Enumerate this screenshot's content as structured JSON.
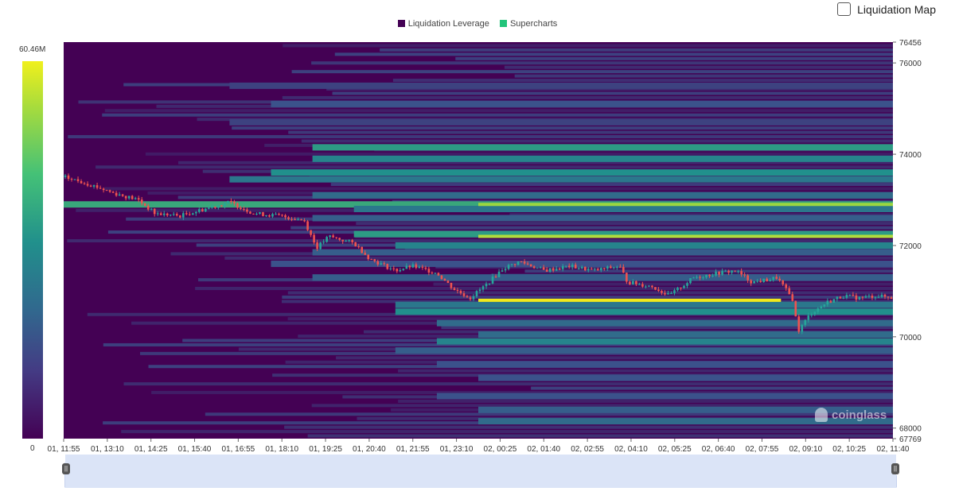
{
  "legend": [
    {
      "label": "Liquidation Leverage",
      "color": "#440154"
    },
    {
      "label": "Supercharts",
      "color": "#22c47a"
    }
  ],
  "toggle": {
    "label": "Liquidation Map",
    "checked": false
  },
  "color_scale": {
    "max_label": "60.46M",
    "min_label": "0"
  },
  "watermark": "coinglass",
  "chart_data": {
    "type": "heatmap",
    "ylim": [
      67769,
      76456
    ],
    "y_ticks": [
      "76456",
      "76000",
      "74000",
      "72000",
      "70000",
      "68000",
      "67769"
    ],
    "x_ticks": [
      "01, 11:55",
      "01, 13:10",
      "01, 14:25",
      "01, 15:40",
      "01, 16:55",
      "01, 18:10",
      "01, 19:25",
      "01, 20:40",
      "01, 21:55",
      "01, 23:10",
      "02, 00:25",
      "02, 01:40",
      "02, 02:55",
      "02, 04:10",
      "02, 05:25",
      "02, 06:40",
      "02, 07:55",
      "02, 09:10",
      "02, 10:25",
      "02, 11:40"
    ],
    "colorscale": [
      "#440154",
      "#3b528b",
      "#21908c",
      "#5ec962",
      "#fde725"
    ],
    "liquidation_levels": [
      {
        "price": 72900,
        "start": 0.0,
        "end": 1.0,
        "intensity": 0.6
      },
      {
        "price": 72250,
        "start": 0.35,
        "end": 1.0,
        "intensity": 0.55
      },
      {
        "price": 74150,
        "start": 0.3,
        "end": 1.0,
        "intensity": 0.55
      },
      {
        "price": 73900,
        "start": 0.3,
        "end": 1.0,
        "intensity": 0.45
      },
      {
        "price": 73600,
        "start": 0.25,
        "end": 1.0,
        "intensity": 0.5
      },
      {
        "price": 73450,
        "start": 0.2,
        "end": 1.0,
        "intensity": 0.4
      },
      {
        "price": 73100,
        "start": 0.3,
        "end": 1.0,
        "intensity": 0.35
      },
      {
        "price": 72800,
        "start": 0.35,
        "end": 1.0,
        "intensity": 0.4
      },
      {
        "price": 72600,
        "start": 0.3,
        "end": 1.0,
        "intensity": 0.3
      },
      {
        "price": 72000,
        "start": 0.4,
        "end": 1.0,
        "intensity": 0.45
      },
      {
        "price": 71850,
        "start": 0.3,
        "end": 1.0,
        "intensity": 0.3
      },
      {
        "price": 71600,
        "start": 0.25,
        "end": 1.0,
        "intensity": 0.25
      },
      {
        "price": 71300,
        "start": 0.3,
        "end": 1.0,
        "intensity": 0.3
      },
      {
        "price": 70700,
        "start": 0.4,
        "end": 1.0,
        "intensity": 0.4
      },
      {
        "price": 70550,
        "start": 0.4,
        "end": 1.0,
        "intensity": 0.5
      },
      {
        "price": 70300,
        "start": 0.45,
        "end": 1.0,
        "intensity": 0.35
      },
      {
        "price": 70050,
        "start": 0.5,
        "end": 1.0,
        "intensity": 0.35
      },
      {
        "price": 69900,
        "start": 0.45,
        "end": 1.0,
        "intensity": 0.45
      },
      {
        "price": 69700,
        "start": 0.4,
        "end": 1.0,
        "intensity": 0.3
      },
      {
        "price": 69400,
        "start": 0.45,
        "end": 1.0,
        "intensity": 0.25
      },
      {
        "price": 69100,
        "start": 0.5,
        "end": 1.0,
        "intensity": 0.25
      },
      {
        "price": 68700,
        "start": 0.45,
        "end": 1.0,
        "intensity": 0.25
      },
      {
        "price": 68400,
        "start": 0.5,
        "end": 1.0,
        "intensity": 0.3
      },
      {
        "price": 68150,
        "start": 0.5,
        "end": 1.0,
        "intensity": 0.35
      },
      {
        "price": 75500,
        "start": 0.2,
        "end": 1.0,
        "intensity": 0.2
      },
      {
        "price": 75100,
        "start": 0.25,
        "end": 1.0,
        "intensity": 0.25
      },
      {
        "price": 74700,
        "start": 0.2,
        "end": 1.0,
        "intensity": 0.2
      }
    ],
    "highlight_levels": [
      {
        "price": 72900,
        "start": 0.5,
        "end": 1.0,
        "color": "#9bd640"
      },
      {
        "price": 72200,
        "start": 0.5,
        "end": 1.0,
        "color": "#b0dc3c"
      },
      {
        "price": 70800,
        "start": 0.5,
        "end": 0.865,
        "color": "#f0e81c"
      }
    ],
    "price_series": [
      {
        "t": 0.0,
        "p": 73500
      },
      {
        "t": 0.03,
        "p": 73350
      },
      {
        "t": 0.06,
        "p": 73150
      },
      {
        "t": 0.09,
        "p": 73000
      },
      {
        "t": 0.11,
        "p": 72700
      },
      {
        "t": 0.14,
        "p": 72650
      },
      {
        "t": 0.17,
        "p": 72800
      },
      {
        "t": 0.2,
        "p": 72950
      },
      {
        "t": 0.23,
        "p": 72700
      },
      {
        "t": 0.26,
        "p": 72650
      },
      {
        "t": 0.29,
        "p": 72550
      },
      {
        "t": 0.305,
        "p": 71950
      },
      {
        "t": 0.32,
        "p": 72200
      },
      {
        "t": 0.35,
        "p": 72050
      },
      {
        "t": 0.37,
        "p": 71700
      },
      {
        "t": 0.4,
        "p": 71450
      },
      {
        "t": 0.42,
        "p": 71550
      },
      {
        "t": 0.45,
        "p": 71400
      },
      {
        "t": 0.47,
        "p": 71050
      },
      {
        "t": 0.49,
        "p": 70850
      },
      {
        "t": 0.51,
        "p": 71150
      },
      {
        "t": 0.53,
        "p": 71500
      },
      {
        "t": 0.55,
        "p": 71650
      },
      {
        "t": 0.58,
        "p": 71450
      },
      {
        "t": 0.61,
        "p": 71550
      },
      {
        "t": 0.64,
        "p": 71450
      },
      {
        "t": 0.67,
        "p": 71550
      },
      {
        "t": 0.68,
        "p": 71200
      },
      {
        "t": 0.71,
        "p": 71100
      },
      {
        "t": 0.73,
        "p": 70900
      },
      {
        "t": 0.76,
        "p": 71300
      },
      {
        "t": 0.79,
        "p": 71400
      },
      {
        "t": 0.81,
        "p": 71450
      },
      {
        "t": 0.83,
        "p": 71200
      },
      {
        "t": 0.85,
        "p": 71250
      },
      {
        "t": 0.86,
        "p": 71300
      },
      {
        "t": 0.88,
        "p": 70800
      },
      {
        "t": 0.885,
        "p": 70100
      },
      {
        "t": 0.9,
        "p": 70500
      },
      {
        "t": 0.92,
        "p": 70750
      },
      {
        "t": 0.94,
        "p": 70900
      },
      {
        "t": 0.96,
        "p": 70850
      },
      {
        "t": 0.98,
        "p": 70900
      },
      {
        "t": 1.0,
        "p": 70850
      }
    ]
  }
}
